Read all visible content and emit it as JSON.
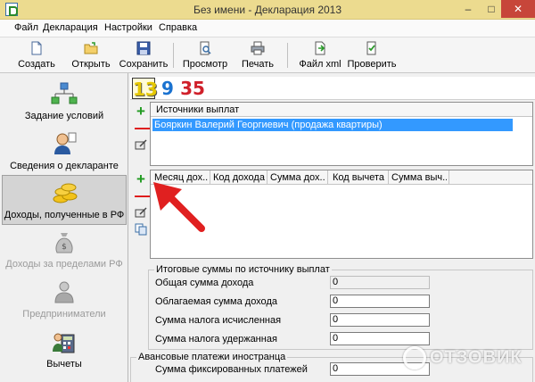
{
  "window": {
    "title": "Без имени - Декларация 2013"
  },
  "menu": [
    "Файл",
    "Декларация",
    "Настройки",
    "Справка"
  ],
  "toolbar": {
    "create": "Создать",
    "open": "Открыть",
    "save": "Сохранить",
    "preview": "Просмотр",
    "print": "Печать",
    "xml": "Файл xml",
    "check": "Проверить"
  },
  "nav": [
    {
      "label": "Задание условий",
      "icon": "structure-icon"
    },
    {
      "label": "Сведения о декларанте",
      "icon": "person-icon"
    },
    {
      "label": "Доходы, полученные в РФ",
      "icon": "coins-icon"
    },
    {
      "label": "Доходы за пределами РФ",
      "icon": "money-bag-icon"
    },
    {
      "label": "Предприниматели",
      "icon": "businessman-icon"
    },
    {
      "label": "Вычеты",
      "icon": "calculator-icon"
    }
  ],
  "rates": [
    "13",
    "9",
    "35"
  ],
  "sources": {
    "header": "Источники выплат",
    "rows": [
      "Бояркин Валерий Георгиевич (продажа квартиры)"
    ]
  },
  "income_table": {
    "columns": [
      "Месяц дох...",
      "Код дохода",
      "Сумма дох...",
      "Код вычета",
      "Сумма выч..."
    ]
  },
  "totals": {
    "title": "Итоговые суммы по источнику выплат",
    "fields": [
      {
        "label": "Общая сумма дохода",
        "value": "0"
      },
      {
        "label": "Облагаемая сумма дохода",
        "value": "0"
      },
      {
        "label": "Сумма налога исчисленная",
        "value": "0"
      },
      {
        "label": "Сумма налога удержанная",
        "value": "0"
      }
    ]
  },
  "advance": {
    "title": "Авансовые платежи иностранца",
    "fields": [
      {
        "label": "Сумма фиксированных платежей",
        "value": "0"
      }
    ]
  },
  "watermark": "ОТЗОВИК",
  "colors": {
    "selection": "#3399ff",
    "titlebar": "#ecdb8f",
    "add": "#1f9a1f",
    "remove": "#dd1111",
    "arrow": "#e02020"
  }
}
